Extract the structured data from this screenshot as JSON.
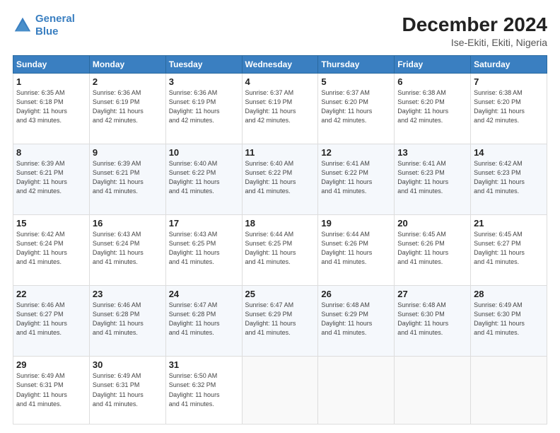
{
  "header": {
    "logo_line1": "General",
    "logo_line2": "Blue",
    "title": "December 2024",
    "subtitle": "Ise-Ekiti, Ekiti, Nigeria"
  },
  "days_of_week": [
    "Sunday",
    "Monday",
    "Tuesday",
    "Wednesday",
    "Thursday",
    "Friday",
    "Saturday"
  ],
  "weeks": [
    [
      {
        "day": "1",
        "info": "Sunrise: 6:35 AM\nSunset: 6:18 PM\nDaylight: 11 hours\nand 43 minutes."
      },
      {
        "day": "2",
        "info": "Sunrise: 6:36 AM\nSunset: 6:19 PM\nDaylight: 11 hours\nand 42 minutes."
      },
      {
        "day": "3",
        "info": "Sunrise: 6:36 AM\nSunset: 6:19 PM\nDaylight: 11 hours\nand 42 minutes."
      },
      {
        "day": "4",
        "info": "Sunrise: 6:37 AM\nSunset: 6:19 PM\nDaylight: 11 hours\nand 42 minutes."
      },
      {
        "day": "5",
        "info": "Sunrise: 6:37 AM\nSunset: 6:20 PM\nDaylight: 11 hours\nand 42 minutes."
      },
      {
        "day": "6",
        "info": "Sunrise: 6:38 AM\nSunset: 6:20 PM\nDaylight: 11 hours\nand 42 minutes."
      },
      {
        "day": "7",
        "info": "Sunrise: 6:38 AM\nSunset: 6:20 PM\nDaylight: 11 hours\nand 42 minutes."
      }
    ],
    [
      {
        "day": "8",
        "info": "Sunrise: 6:39 AM\nSunset: 6:21 PM\nDaylight: 11 hours\nand 42 minutes."
      },
      {
        "day": "9",
        "info": "Sunrise: 6:39 AM\nSunset: 6:21 PM\nDaylight: 11 hours\nand 41 minutes."
      },
      {
        "day": "10",
        "info": "Sunrise: 6:40 AM\nSunset: 6:22 PM\nDaylight: 11 hours\nand 41 minutes."
      },
      {
        "day": "11",
        "info": "Sunrise: 6:40 AM\nSunset: 6:22 PM\nDaylight: 11 hours\nand 41 minutes."
      },
      {
        "day": "12",
        "info": "Sunrise: 6:41 AM\nSunset: 6:22 PM\nDaylight: 11 hours\nand 41 minutes."
      },
      {
        "day": "13",
        "info": "Sunrise: 6:41 AM\nSunset: 6:23 PM\nDaylight: 11 hours\nand 41 minutes."
      },
      {
        "day": "14",
        "info": "Sunrise: 6:42 AM\nSunset: 6:23 PM\nDaylight: 11 hours\nand 41 minutes."
      }
    ],
    [
      {
        "day": "15",
        "info": "Sunrise: 6:42 AM\nSunset: 6:24 PM\nDaylight: 11 hours\nand 41 minutes."
      },
      {
        "day": "16",
        "info": "Sunrise: 6:43 AM\nSunset: 6:24 PM\nDaylight: 11 hours\nand 41 minutes."
      },
      {
        "day": "17",
        "info": "Sunrise: 6:43 AM\nSunset: 6:25 PM\nDaylight: 11 hours\nand 41 minutes."
      },
      {
        "day": "18",
        "info": "Sunrise: 6:44 AM\nSunset: 6:25 PM\nDaylight: 11 hours\nand 41 minutes."
      },
      {
        "day": "19",
        "info": "Sunrise: 6:44 AM\nSunset: 6:26 PM\nDaylight: 11 hours\nand 41 minutes."
      },
      {
        "day": "20",
        "info": "Sunrise: 6:45 AM\nSunset: 6:26 PM\nDaylight: 11 hours\nand 41 minutes."
      },
      {
        "day": "21",
        "info": "Sunrise: 6:45 AM\nSunset: 6:27 PM\nDaylight: 11 hours\nand 41 minutes."
      }
    ],
    [
      {
        "day": "22",
        "info": "Sunrise: 6:46 AM\nSunset: 6:27 PM\nDaylight: 11 hours\nand 41 minutes."
      },
      {
        "day": "23",
        "info": "Sunrise: 6:46 AM\nSunset: 6:28 PM\nDaylight: 11 hours\nand 41 minutes."
      },
      {
        "day": "24",
        "info": "Sunrise: 6:47 AM\nSunset: 6:28 PM\nDaylight: 11 hours\nand 41 minutes."
      },
      {
        "day": "25",
        "info": "Sunrise: 6:47 AM\nSunset: 6:29 PM\nDaylight: 11 hours\nand 41 minutes."
      },
      {
        "day": "26",
        "info": "Sunrise: 6:48 AM\nSunset: 6:29 PM\nDaylight: 11 hours\nand 41 minutes."
      },
      {
        "day": "27",
        "info": "Sunrise: 6:48 AM\nSunset: 6:30 PM\nDaylight: 11 hours\nand 41 minutes."
      },
      {
        "day": "28",
        "info": "Sunrise: 6:49 AM\nSunset: 6:30 PM\nDaylight: 11 hours\nand 41 minutes."
      }
    ],
    [
      {
        "day": "29",
        "info": "Sunrise: 6:49 AM\nSunset: 6:31 PM\nDaylight: 11 hours\nand 41 minutes."
      },
      {
        "day": "30",
        "info": "Sunrise: 6:49 AM\nSunset: 6:31 PM\nDaylight: 11 hours\nand 41 minutes."
      },
      {
        "day": "31",
        "info": "Sunrise: 6:50 AM\nSunset: 6:32 PM\nDaylight: 11 hours\nand 41 minutes."
      },
      {
        "day": "",
        "info": ""
      },
      {
        "day": "",
        "info": ""
      },
      {
        "day": "",
        "info": ""
      },
      {
        "day": "",
        "info": ""
      }
    ]
  ]
}
